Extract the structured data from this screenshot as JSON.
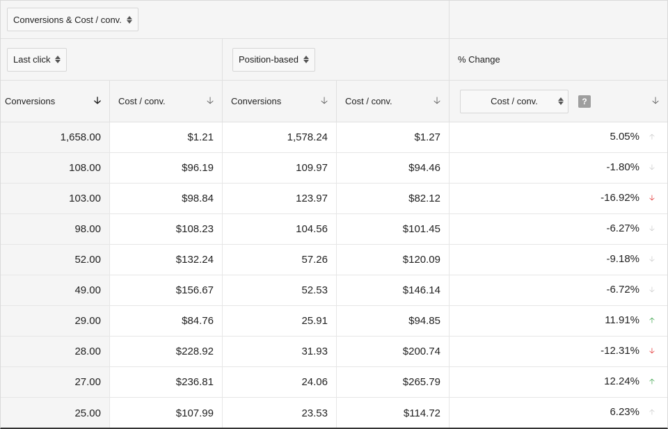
{
  "top_select": {
    "label": "Conversions & Cost / conv."
  },
  "models": {
    "left": {
      "label": "Last click"
    },
    "right": {
      "label": "Position-based"
    },
    "change_label": "% Change"
  },
  "columns": {
    "c1": "Conversions",
    "c2": "Cost / conv.",
    "c3": "Conversions",
    "c4": "Cost / conv.",
    "c5_select": "Cost / conv.",
    "help": "?"
  },
  "rows": [
    {
      "lc_conv": "1,658.00",
      "lc_cost": "$1.21",
      "pb_conv": "1,578.24",
      "pb_cost": "$1.27",
      "change": "5.05%",
      "trend": "up-gray"
    },
    {
      "lc_conv": "108.00",
      "lc_cost": "$96.19",
      "pb_conv": "109.97",
      "pb_cost": "$94.46",
      "change": "-1.80%",
      "trend": "down-gray"
    },
    {
      "lc_conv": "103.00",
      "lc_cost": "$98.84",
      "pb_conv": "123.97",
      "pb_cost": "$82.12",
      "change": "-16.92%",
      "trend": "down-red"
    },
    {
      "lc_conv": "98.00",
      "lc_cost": "$108.23",
      "pb_conv": "104.56",
      "pb_cost": "$101.45",
      "change": "-6.27%",
      "trend": "down-gray"
    },
    {
      "lc_conv": "52.00",
      "lc_cost": "$132.24",
      "pb_conv": "57.26",
      "pb_cost": "$120.09",
      "change": "-9.18%",
      "trend": "down-gray"
    },
    {
      "lc_conv": "49.00",
      "lc_cost": "$156.67",
      "pb_conv": "52.53",
      "pb_cost": "$146.14",
      "change": "-6.72%",
      "trend": "down-gray"
    },
    {
      "lc_conv": "29.00",
      "lc_cost": "$84.76",
      "pb_conv": "25.91",
      "pb_cost": "$94.85",
      "change": "11.91%",
      "trend": "up-green"
    },
    {
      "lc_conv": "28.00",
      "lc_cost": "$228.92",
      "pb_conv": "31.93",
      "pb_cost": "$200.74",
      "change": "-12.31%",
      "trend": "down-red"
    },
    {
      "lc_conv": "27.00",
      "lc_cost": "$236.81",
      "pb_conv": "24.06",
      "pb_cost": "$265.79",
      "change": "12.24%",
      "trend": "up-green"
    },
    {
      "lc_conv": "25.00",
      "lc_cost": "$107.99",
      "pb_conv": "23.53",
      "pb_cost": "$114.72",
      "change": "6.23%",
      "trend": "up-gray"
    }
  ],
  "colors": {
    "up": "#2e9e3f",
    "down": "#e02020",
    "neutral": "#c8c8c8"
  }
}
